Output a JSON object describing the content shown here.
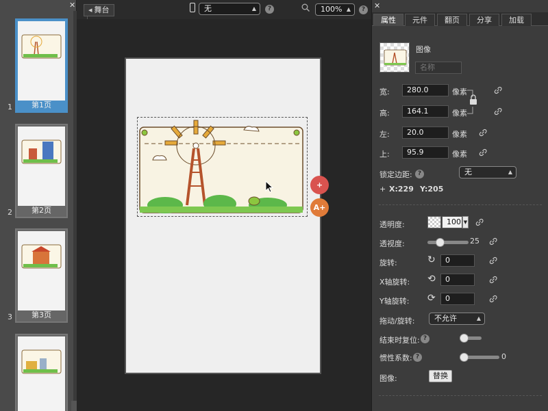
{
  "pages": {
    "items": [
      {
        "num": "1",
        "label": "第1页",
        "active": true
      },
      {
        "num": "2",
        "label": "第2页",
        "active": false
      },
      {
        "num": "3",
        "label": "第3页",
        "active": false
      },
      {
        "num": "",
        "label": "",
        "active": false
      }
    ]
  },
  "toolbar": {
    "stage_tab": "舞台",
    "device_value": "无",
    "zoom_value": "100%"
  },
  "tabs": [
    "属性",
    "元件",
    "翻页",
    "分享",
    "加载"
  ],
  "props": {
    "type_label": "图像",
    "name_placeholder": "名称",
    "width_label": "宽:",
    "width_value": "280.0",
    "height_label": "高:",
    "height_value": "164.1",
    "left_label": "左:",
    "left_value": "20.0",
    "top_label": "上:",
    "top_value": "95.9",
    "unit": "像素",
    "lock_margin_label": "锁定边距:",
    "lock_margin_value": "无",
    "coords_plus": "+",
    "coord_x": "X:229",
    "coord_y": "Y:205",
    "opacity_label": "透明度:",
    "opacity_value": "100",
    "perspective_label": "透视度:",
    "perspective_value": "25",
    "rotate_label": "旋转:",
    "rotate_value": "0",
    "xrotate_label": "X轴旋转:",
    "xrotate_value": "0",
    "yrotate_label": "Y轴旋转:",
    "yrotate_value": "0",
    "drag_label": "拖动/旋转:",
    "drag_value": "不允许",
    "reset_label": "结束时复位:",
    "inertia_label": "惯性系数:",
    "inertia_value": "0",
    "image_label": "图像:",
    "replace_button": "替换"
  },
  "colors": {
    "accent_blue": "#4a90c8",
    "badge_red": "#d9534f",
    "badge_orange": "#e07b39",
    "canvas_bg": "#efefef"
  }
}
